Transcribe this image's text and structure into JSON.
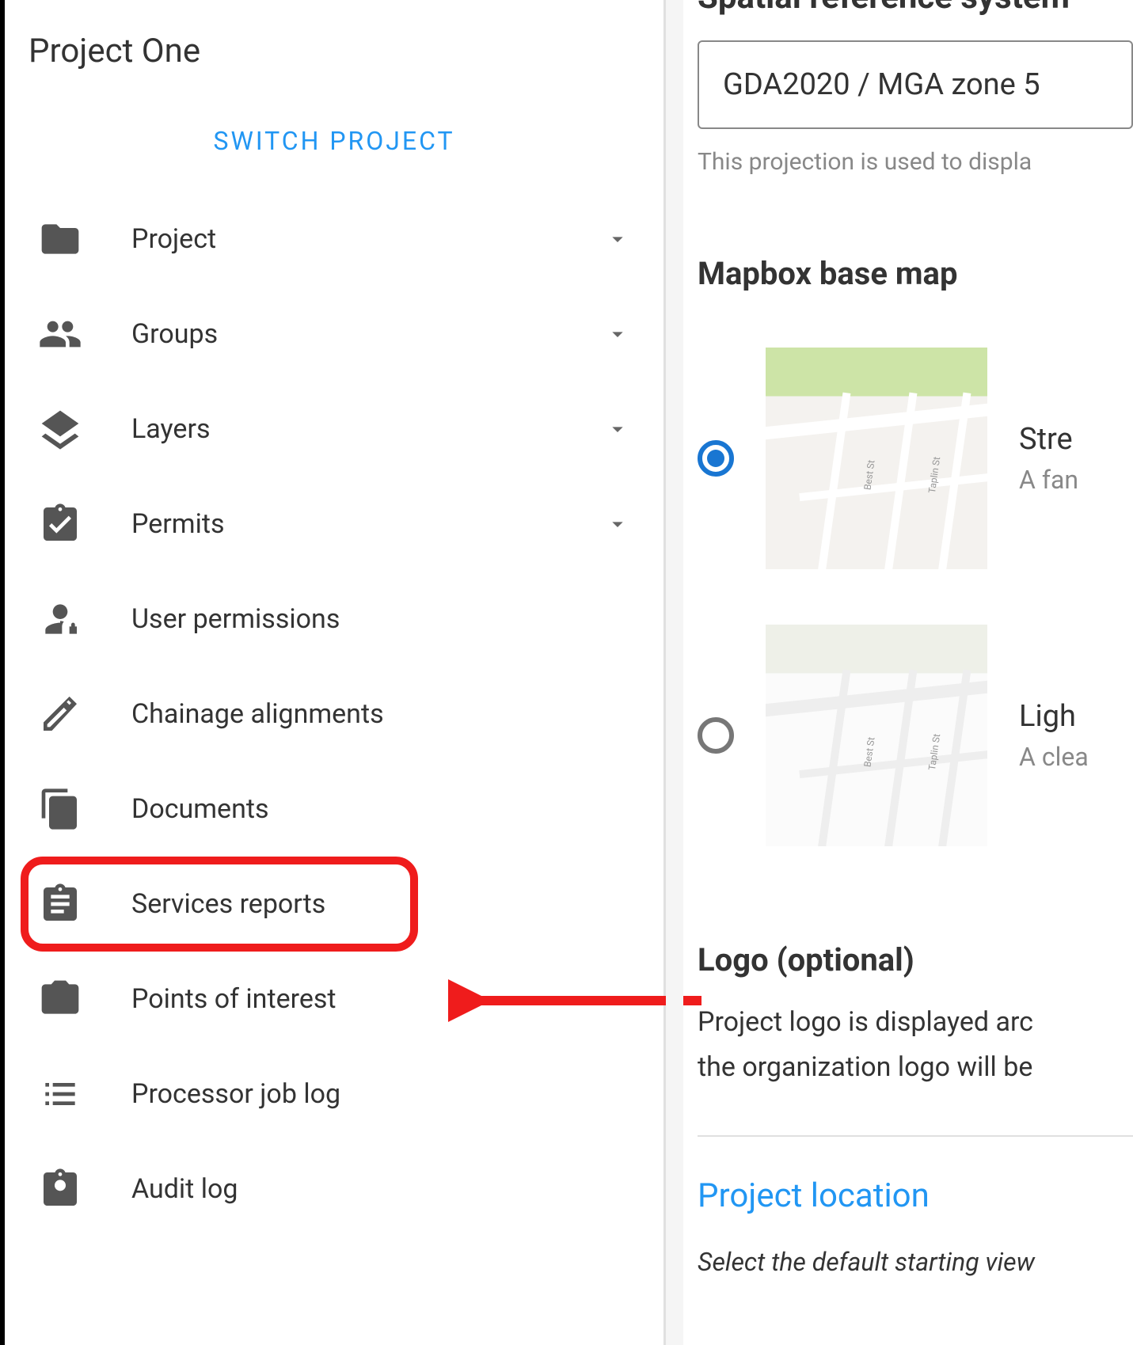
{
  "sidebar": {
    "projectTitle": "Project One",
    "switchProject": "SWITCH PROJECT",
    "items": [
      {
        "label": "Project",
        "expandable": true
      },
      {
        "label": "Groups",
        "expandable": true
      },
      {
        "label": "Layers",
        "expandable": true
      },
      {
        "label": "Permits",
        "expandable": true
      },
      {
        "label": "User permissions",
        "expandable": false
      },
      {
        "label": "Chainage alignments",
        "expandable": false
      },
      {
        "label": "Documents",
        "expandable": false
      },
      {
        "label": "Services reports",
        "expandable": false
      },
      {
        "label": "Points of interest",
        "expandable": false
      },
      {
        "label": "Processor job log",
        "expandable": false
      },
      {
        "label": "Audit log",
        "expandable": false
      }
    ]
  },
  "main": {
    "srsHeading": "Spatial reference system",
    "srsValue": "GDA2020 / MGA zone 5",
    "srsHint": "This projection is used to displa",
    "mapboxHeading": "Mapbox base map",
    "options": [
      {
        "title": "Stre",
        "subtitle": "A fan",
        "selected": true
      },
      {
        "title": "Ligh",
        "subtitle": "A clea",
        "selected": false
      }
    ],
    "logoHeading": "Logo (optional)",
    "logoDesc1": "Project logo is displayed arc",
    "logoDesc2": "the organization logo will be",
    "locationHeading": "Project location",
    "locationDesc": "Select the default starting view"
  }
}
